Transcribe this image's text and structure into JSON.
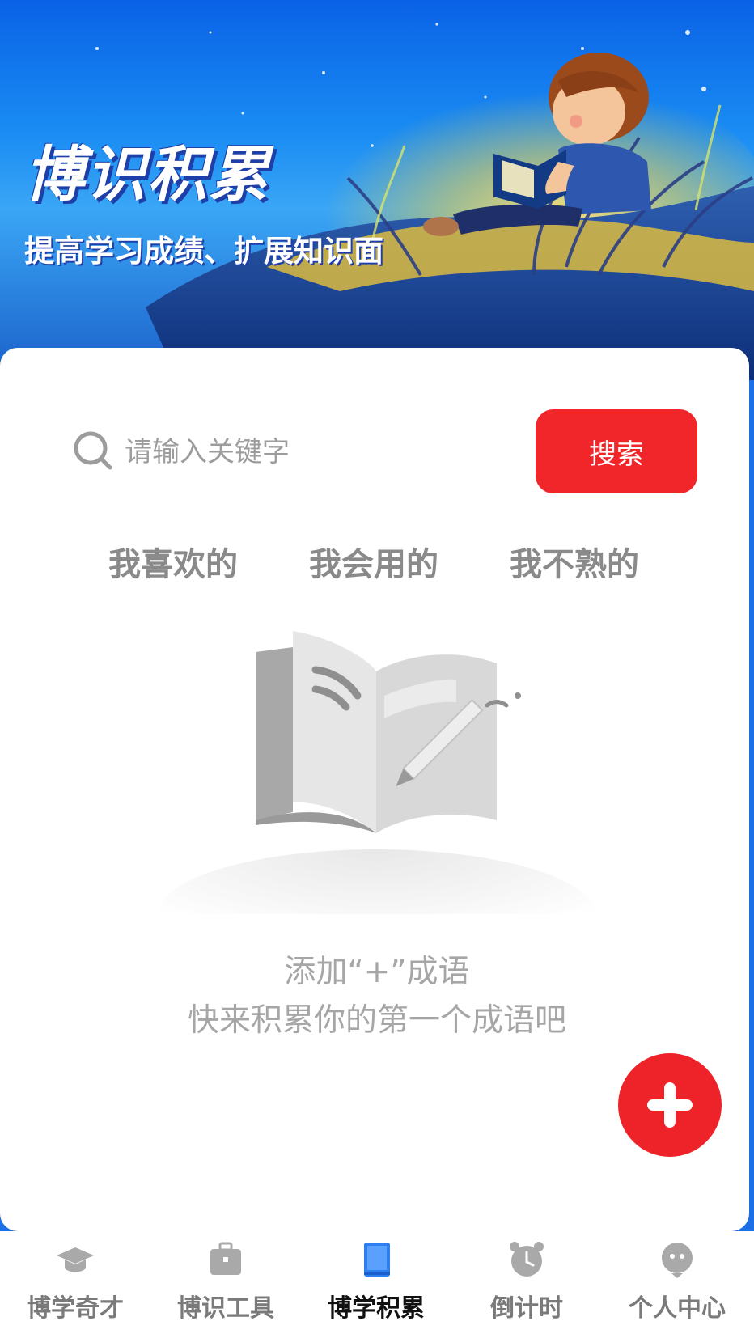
{
  "banner": {
    "title": "博识积累",
    "subtitle": "提高学习成绩、扩展知识面"
  },
  "search": {
    "placeholder": "请输入关键字",
    "value": "",
    "button_label": "搜索"
  },
  "tabs": [
    {
      "label": "我喜欢的"
    },
    {
      "label": "我会用的"
    },
    {
      "label": "我不熟的"
    }
  ],
  "empty_state": {
    "line1": "添加“+”成语",
    "line2": "快来积累你的第一个成语吧"
  },
  "fab": {
    "icon": "plus-icon"
  },
  "bottom_nav": {
    "items": [
      {
        "label": "博学奇才",
        "icon": "graduation-cap-icon",
        "active": false
      },
      {
        "label": "博识工具",
        "icon": "briefcase-icon",
        "active": false
      },
      {
        "label": "博学积累",
        "icon": "book-icon",
        "active": true
      },
      {
        "label": "倒计时",
        "icon": "alarm-clock-icon",
        "active": false
      },
      {
        "label": "个人中心",
        "icon": "profile-icon",
        "active": false
      }
    ]
  },
  "colors": {
    "accent": "#f1262a",
    "active_nav": "#2d7ff0",
    "inactive_nav": "#a9a9a9",
    "banner_blue": "#0a62e6"
  }
}
